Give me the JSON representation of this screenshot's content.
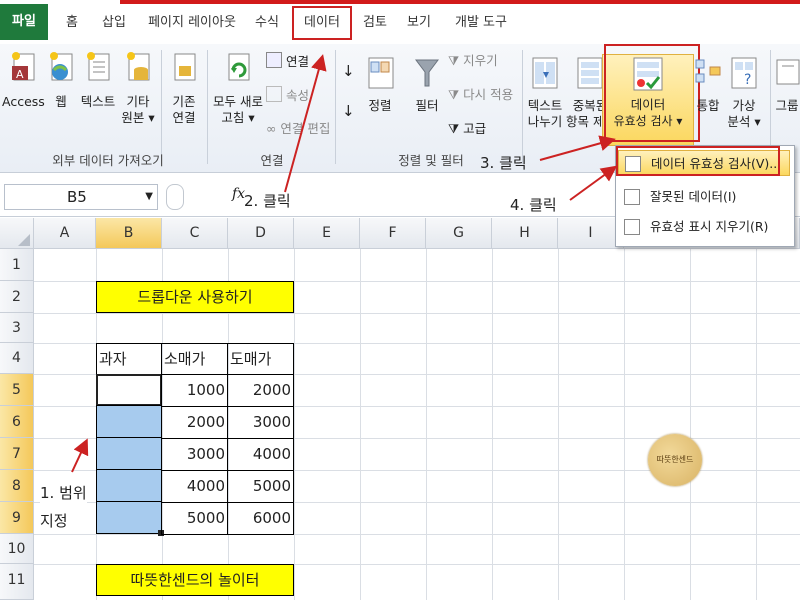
{
  "tabs": {
    "file": "파일",
    "home": "홈",
    "insert": "삽입",
    "page_layout": "페이지 레이아웃",
    "formulas": "수식",
    "data": "데이터",
    "review": "검토",
    "view": "보기",
    "developer": "개발 도구"
  },
  "ribbon": {
    "ext": {
      "access": "Access",
      "web": "웹",
      "text": "텍스트",
      "other_1": "기타",
      "other_2": "원본 ▾",
      "existing_1": "기존",
      "existing_2": "연결",
      "group": "외부 데이터 가져오기"
    },
    "conn": {
      "refresh_1": "모두 새로",
      "refresh_2": "고침 ▾",
      "connections": "연결",
      "properties": "속성",
      "edit_links": "연결 편집",
      "group": "연결"
    },
    "sort": {
      "az": "↓",
      "sort": "정렬",
      "filter": "필터",
      "clear": "지우기",
      "reapply": "다시 적용",
      "advanced": "고급",
      "group": "정렬 및 필터"
    },
    "tools": {
      "text_col_1": "텍스트",
      "text_col_2": "나누기",
      "dup_1": "중복된",
      "dup_2": "항목 제거",
      "dv_1": "데이터",
      "dv_2": "유효성 검사 ▾",
      "consolidate": "통합",
      "whatif_1": "가상",
      "whatif_2": "분석 ▾",
      "group_btn": "그룹"
    }
  },
  "formula_bar": {
    "name_box": "B5",
    "fx": "fx"
  },
  "grid": {
    "columns": [
      "A",
      "B",
      "C",
      "D",
      "E",
      "F",
      "G",
      "H",
      "I"
    ],
    "rows": [
      "1",
      "2",
      "3",
      "4",
      "5",
      "6",
      "7",
      "8",
      "9",
      "10",
      "11"
    ],
    "title": "드롭다운 사용하기",
    "headers": [
      "과자",
      "소매가",
      "도매가"
    ],
    "retail": [
      "1000",
      "2000",
      "3000",
      "4000",
      "5000"
    ],
    "wholesale": [
      "2000",
      "3000",
      "4000",
      "5000",
      "6000"
    ],
    "footer": "따뜻한센드의 놀이터"
  },
  "menu": {
    "item1": "데이터 유효성 검사(V)...",
    "item2": "잘못된 데이터(I)",
    "item3": "유효성 표시 지우기(R)"
  },
  "annotations": {
    "step1_a": "1. 범위",
    "step1_b": "지정",
    "step2": "2. 클릭",
    "step3": "3. 클릭",
    "step4": "4. 클릭"
  },
  "stamp": "따뜻한센드",
  "colors": {
    "highlight": "#cc2222",
    "title_fill": "#ffff00",
    "selection": "#a7cbee",
    "file_tab": "#1f7a3c"
  }
}
